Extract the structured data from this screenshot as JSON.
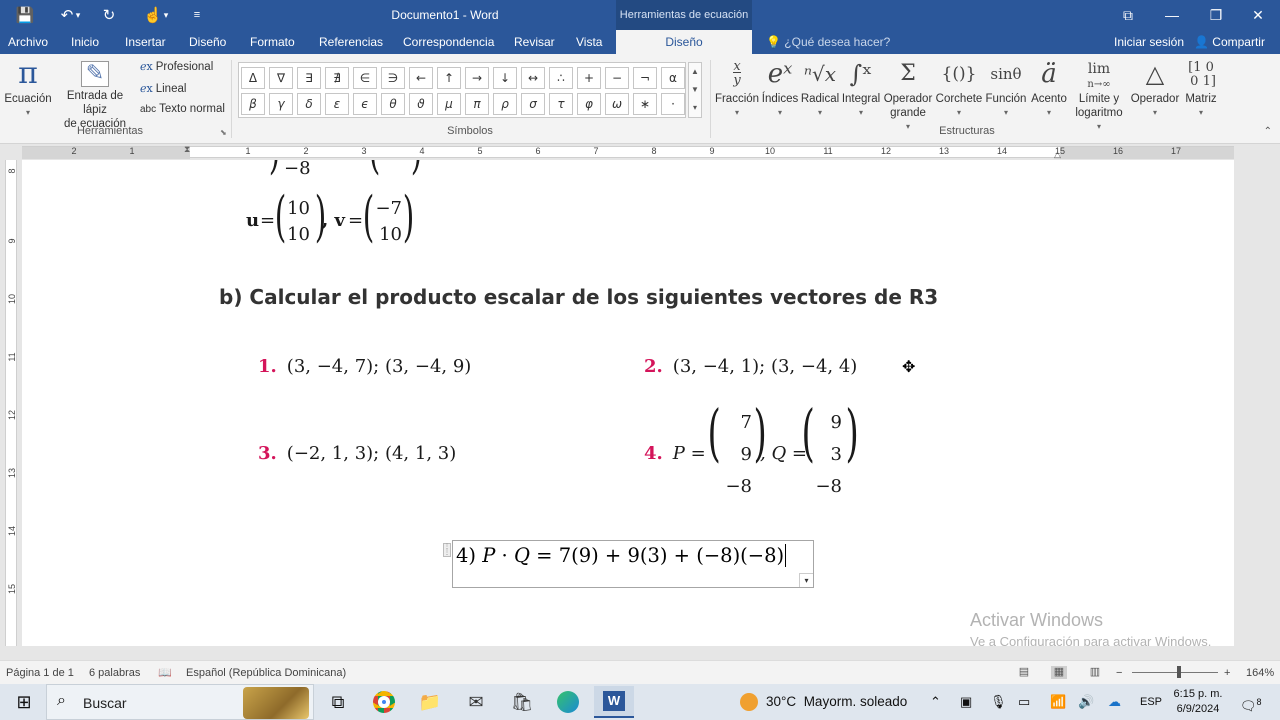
{
  "titlebar": {
    "doc_title": "Documento1 - Word",
    "contextual_tool": "Herramientas de ecuación"
  },
  "tabs": [
    "Archivo",
    "Inicio",
    "Insertar",
    "Diseño",
    "Formato",
    "Referencias",
    "Correspondencia",
    "Revisar",
    "Vista",
    "Diseño"
  ],
  "tell_me": "¿Qué desea hacer?",
  "signin": "Iniciar sesión",
  "share": "Compartir",
  "ribbon": {
    "tools": {
      "equation": "Ecuación",
      "ink_equation_1": "Entrada de lápiz",
      "ink_equation_2": "de ecuación",
      "professional": "Profesional",
      "linear": "Lineal",
      "normal_text": "Texto normal",
      "group_label": "Herramientas"
    },
    "symbols": {
      "row1": [
        "Δ",
        "∇",
        "∃",
        "∄",
        "∈",
        "∋",
        "←",
        "↑",
        "→",
        "↓",
        "↔",
        "∴",
        "+",
        "−",
        "¬",
        "α"
      ],
      "row2": [
        "β",
        "γ",
        "δ",
        "ε",
        "ϵ",
        "θ",
        "ϑ",
        "μ",
        "π",
        "ρ",
        "σ",
        "τ",
        "φ",
        "ω",
        "∗",
        "·"
      ],
      "group_label": "Símbolos"
    },
    "structures": {
      "items": [
        {
          "icon": "x/y",
          "label": "Fracción",
          "label2": ""
        },
        {
          "icon": "eˣ",
          "label": "Índices",
          "label2": ""
        },
        {
          "icon": "ⁿ√x",
          "label": "Radical",
          "label2": ""
        },
        {
          "icon": "∫",
          "label": "Integral",
          "label2": ""
        },
        {
          "icon": "Σ",
          "label": "Operador",
          "label2": "grande"
        },
        {
          "icon": "{()}",
          "label": "Corchete",
          "label2": ""
        },
        {
          "icon": "sinθ",
          "label": "Función",
          "label2": ""
        },
        {
          "icon": "ä",
          "label": "Acento",
          "label2": ""
        },
        {
          "icon": "lim",
          "label": "Límite y",
          "label2": "logaritmo"
        },
        {
          "icon": "Δ",
          "label": "Operador",
          "label2": ""
        },
        {
          "icon": "[10 01]",
          "label": "Matriz",
          "label2": ""
        }
      ],
      "group_label": "Estructuras"
    }
  },
  "ruler": {
    "numbers": [
      "2",
      "1",
      "1",
      "2",
      "3",
      "4",
      "5",
      "6",
      "7",
      "8",
      "9",
      "10",
      "11",
      "12",
      "13",
      "14",
      "15",
      "16",
      "17"
    ],
    "vertical_numbers": [
      "8",
      "9",
      "10",
      "11",
      "12",
      "13",
      "14",
      "15"
    ]
  },
  "document": {
    "top_partial_left": "−8",
    "top_partial_right": "",
    "uv_label_u": "u",
    "uv_eq1": "=",
    "u_top": "10",
    "u_bottom": "10",
    "uv_comma_v": ", v",
    "uv_eq2": "=",
    "v_top": "−7",
    "v_bottom": "10",
    "heading": "b) Calcular el producto escalar de los siguientes vectores de R3",
    "problem1_num": "1.",
    "problem1": "(3, −4, 7); (3, −4, 9)",
    "problem2_num": "2.",
    "problem2": "(3, −4, 1); (3, −4, 4)",
    "problem3_num": "3.",
    "problem3": "(−2, 1, 3); (4, 1, 3)",
    "problem4_num": "4.",
    "p_label": "P =",
    "p_values": [
      "7",
      "9",
      "−8"
    ],
    "q_label": ", Q =",
    "q_values": [
      "9",
      "3",
      "−8"
    ],
    "equation_prefix": "4) ",
    "equation_p": "P",
    "equation_dot": " · ",
    "equation_q": "Q",
    "equation_rest": " = 7(9) + 9(3) + (−8)(−8)"
  },
  "watermark": {
    "line1": "Activar Windows",
    "line2": "Ve a Configuración para activar Windows."
  },
  "statusbar": {
    "page": "Página 1 de 1",
    "words": "6 palabras",
    "language": "Español (República Dominicana)",
    "zoom": "164%"
  },
  "taskbar": {
    "search": "Buscar",
    "weather_temp": "30°C",
    "weather_desc": "Mayorm. soleado",
    "language": "ESP",
    "time": "6:15 p. m.",
    "date": "6/9/2024",
    "notification_count": "8"
  }
}
